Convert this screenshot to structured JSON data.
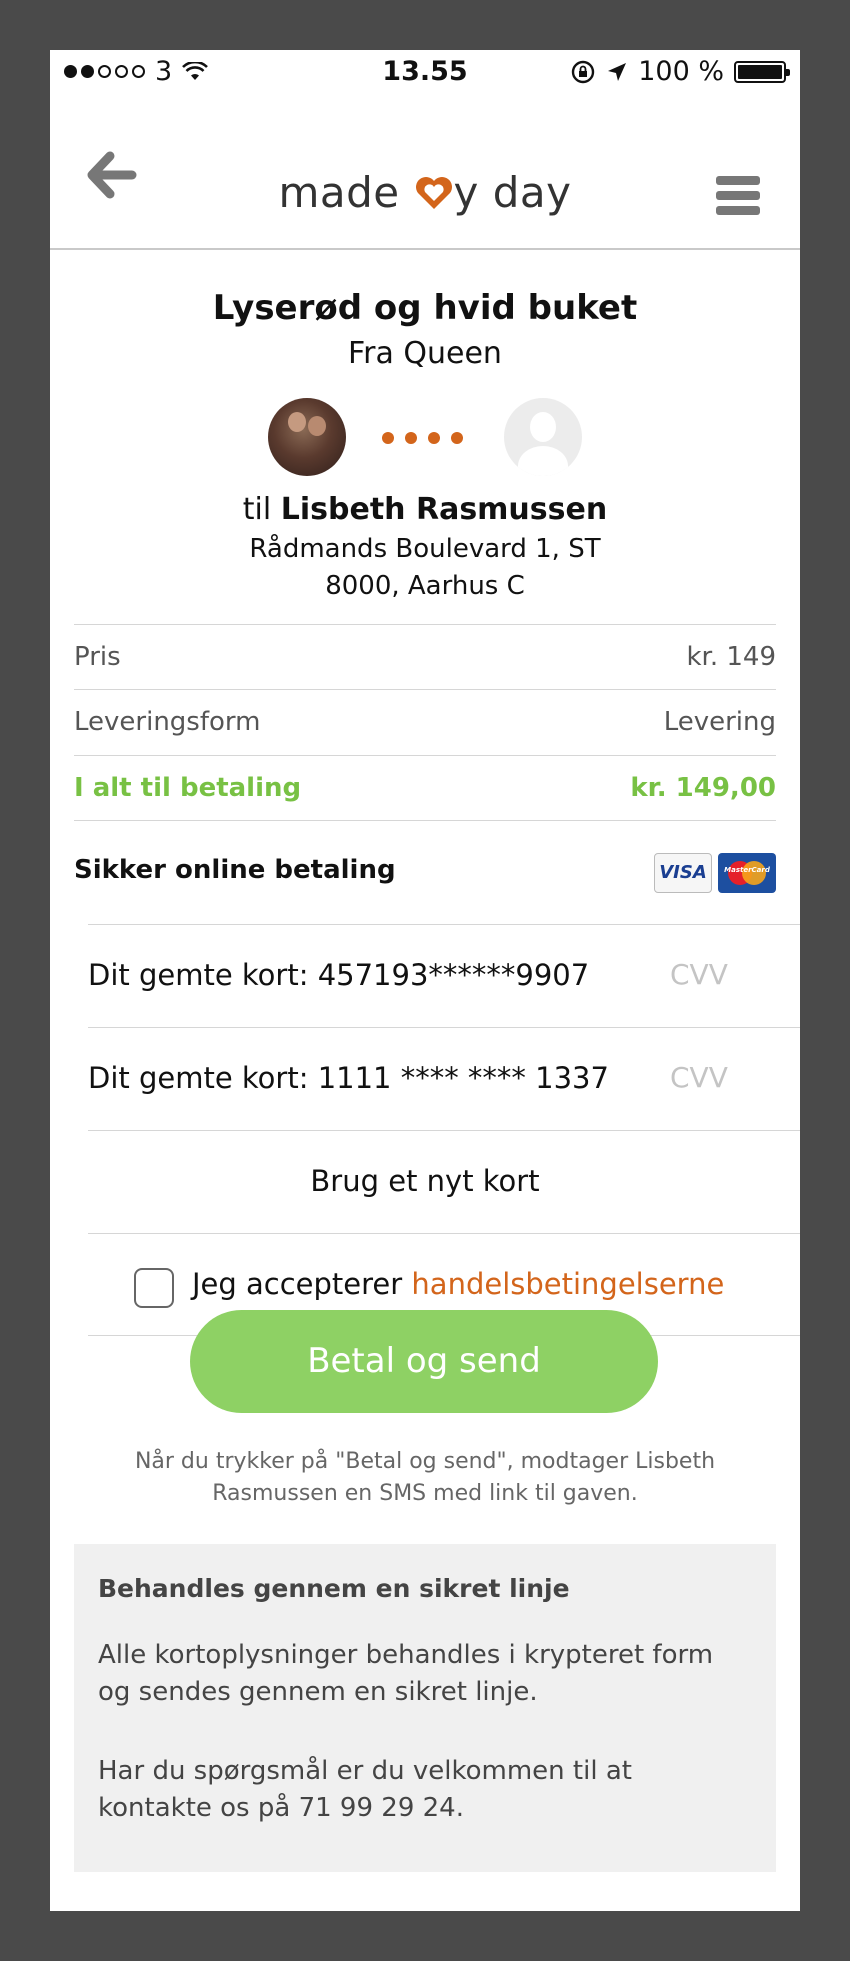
{
  "status_bar": {
    "carrier": "3",
    "time": "13.55",
    "battery": "100 %"
  },
  "nav": {
    "logo_left": "made",
    "logo_right": "y day"
  },
  "gift": {
    "title": "Lyserød og hvid buket",
    "from": "Fra Queen",
    "to_prefix": "til",
    "recipient_name": "Lisbeth Rasmussen",
    "address_line1": "Rådmands Boulevard 1, ST",
    "address_line2": "8000, Aarhus C"
  },
  "summary": {
    "price_label": "Pris",
    "price_value": "kr. 149",
    "delivery_label": "Leveringsform",
    "delivery_value": "Levering",
    "total_label": "I alt til betaling",
    "total_value": "kr. 149,00",
    "secure_label": "Sikker online betaling",
    "visa_label": "VISA",
    "mastercard_label": "MasterCard"
  },
  "payment": {
    "saved_cards": [
      {
        "label": "Dit gemte kort: 457193******9907",
        "cvv_placeholder": "CVV"
      },
      {
        "label": "Dit gemte kort: 1111 **** **** 1337",
        "cvv_placeholder": "CVV"
      }
    ],
    "new_card_label": "Brug et nyt kort",
    "accept_prefix": "Jeg accepterer ",
    "accept_link": "handelsbetingelserne",
    "pay_button": "Betal og send",
    "note": "Når du trykker på \"Betal og send\", modtager Lisbeth Rasmussen en SMS med link til gaven."
  },
  "info": {
    "heading": "Behandles gennem en sikret linje",
    "paragraph1": "Alle kortoplysninger behandles i krypteret form og sendes gennem en sikret linje.",
    "paragraph2": "Har du spørgsmål er du velkommen til at kontakte os på 71 99 29 24."
  },
  "colors": {
    "accent_green": "#8ed164",
    "total_green": "#78c144",
    "brand_orange": "#d3651b"
  }
}
